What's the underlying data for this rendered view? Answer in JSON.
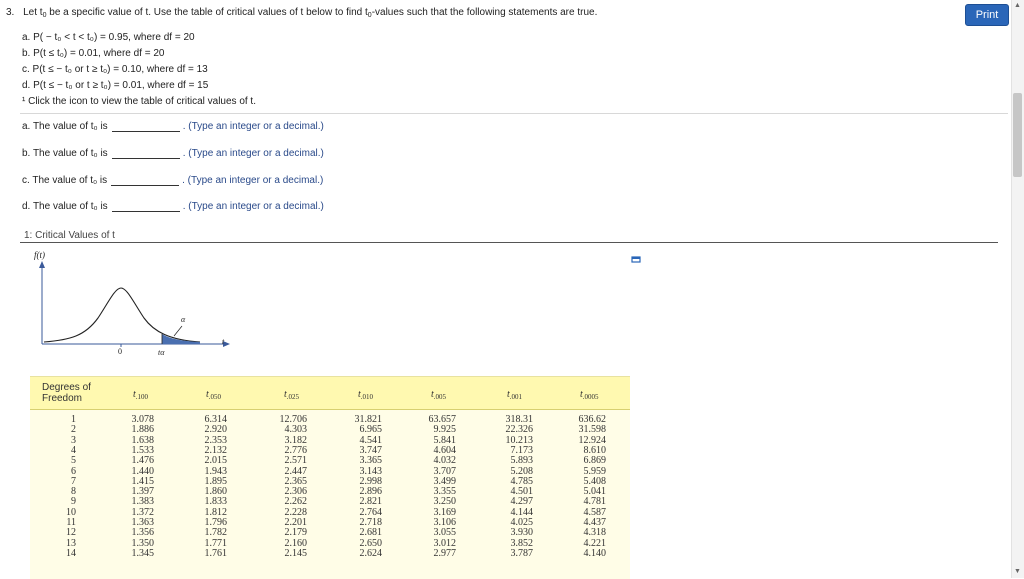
{
  "question": {
    "number": "3.",
    "intro_a": "Let t",
    "intro_b": " be a specific value of t. Use the table of critical values of t below to find t",
    "intro_c": "-values such that the following statements are true.",
    "sub0": "0",
    "items": [
      {
        "text": "a. P( − t₀ < t < t₀) = 0.95, where df = 20"
      },
      {
        "text": "b. P(t ≤ t₀) = 0.01, where df = 20"
      },
      {
        "text": "c. P(t ≤ − t₀ or t ≥ t₀) = 0.10, where df = 13"
      },
      {
        "text": "d. P(t ≤ − t₀ or t ≥ t₀) = 0.01, where df = 15"
      }
    ],
    "footnote": "¹ Click the icon to view the table of critical values of t."
  },
  "print_label": "Print",
  "answers": [
    {
      "prefix": "a. The value of t₀ is",
      "hint": ". (Type an integer or a decimal.)"
    },
    {
      "prefix": "b. The value of t₀ is",
      "hint": ". (Type an integer or a decimal.)"
    },
    {
      "prefix": "c. The value of t₀ is",
      "hint": ". (Type an integer or a decimal.)"
    },
    {
      "prefix": "d. The value of t₀ is",
      "hint": ". (Type an integer or a decimal.)"
    }
  ],
  "critical": {
    "title": "1: Critical Values of t",
    "graph": {
      "ylabel": "f(t)",
      "xlabel": "t",
      "zero": "0",
      "alpha": "α",
      "talpha": "tα"
    },
    "table": {
      "degrees_header": "Degrees of Freedom",
      "columns": [
        {
          "label": "t",
          "sub": ".100"
        },
        {
          "label": "t",
          "sub": ".050"
        },
        {
          "label": "t",
          "sub": ".025"
        },
        {
          "label": "t",
          "sub": ".010"
        },
        {
          "label": "t",
          "sub": ".005"
        },
        {
          "label": "t",
          "sub": ".001"
        },
        {
          "label": "t",
          "sub": ".0005"
        }
      ],
      "rows": [
        [
          "1",
          "3.078",
          "6.314",
          "12.706",
          "31.821",
          "63.657",
          "318.31",
          "636.62"
        ],
        [
          "2",
          "1.886",
          "2.920",
          "4.303",
          "6.965",
          "9.925",
          "22.326",
          "31.598"
        ],
        [
          "3",
          "1.638",
          "2.353",
          "3.182",
          "4.541",
          "5.841",
          "10.213",
          "12.924"
        ],
        [
          "4",
          "1.533",
          "2.132",
          "2.776",
          "3.747",
          "4.604",
          "7.173",
          "8.610"
        ],
        [
          "5",
          "1.476",
          "2.015",
          "2.571",
          "3.365",
          "4.032",
          "5.893",
          "6.869"
        ],
        [
          "6",
          "1.440",
          "1.943",
          "2.447",
          "3.143",
          "3.707",
          "5.208",
          "5.959"
        ],
        [
          "7",
          "1.415",
          "1.895",
          "2.365",
          "2.998",
          "3.499",
          "4.785",
          "5.408"
        ],
        [
          "8",
          "1.397",
          "1.860",
          "2.306",
          "2.896",
          "3.355",
          "4.501",
          "5.041"
        ],
        [
          "9",
          "1.383",
          "1.833",
          "2.262",
          "2.821",
          "3.250",
          "4.297",
          "4.781"
        ],
        [
          "10",
          "1.372",
          "1.812",
          "2.228",
          "2.764",
          "3.169",
          "4.144",
          "4.587"
        ],
        [
          "11",
          "1.363",
          "1.796",
          "2.201",
          "2.718",
          "3.106",
          "4.025",
          "4.437"
        ],
        [
          "12",
          "1.356",
          "1.782",
          "2.179",
          "2.681",
          "3.055",
          "3.930",
          "4.318"
        ],
        [
          "13",
          "1.350",
          "1.771",
          "2.160",
          "2.650",
          "3.012",
          "3.852",
          "4.221"
        ],
        [
          "14",
          "1.345",
          "1.761",
          "2.145",
          "2.624",
          "2.977",
          "3.787",
          "4.140"
        ]
      ]
    }
  }
}
